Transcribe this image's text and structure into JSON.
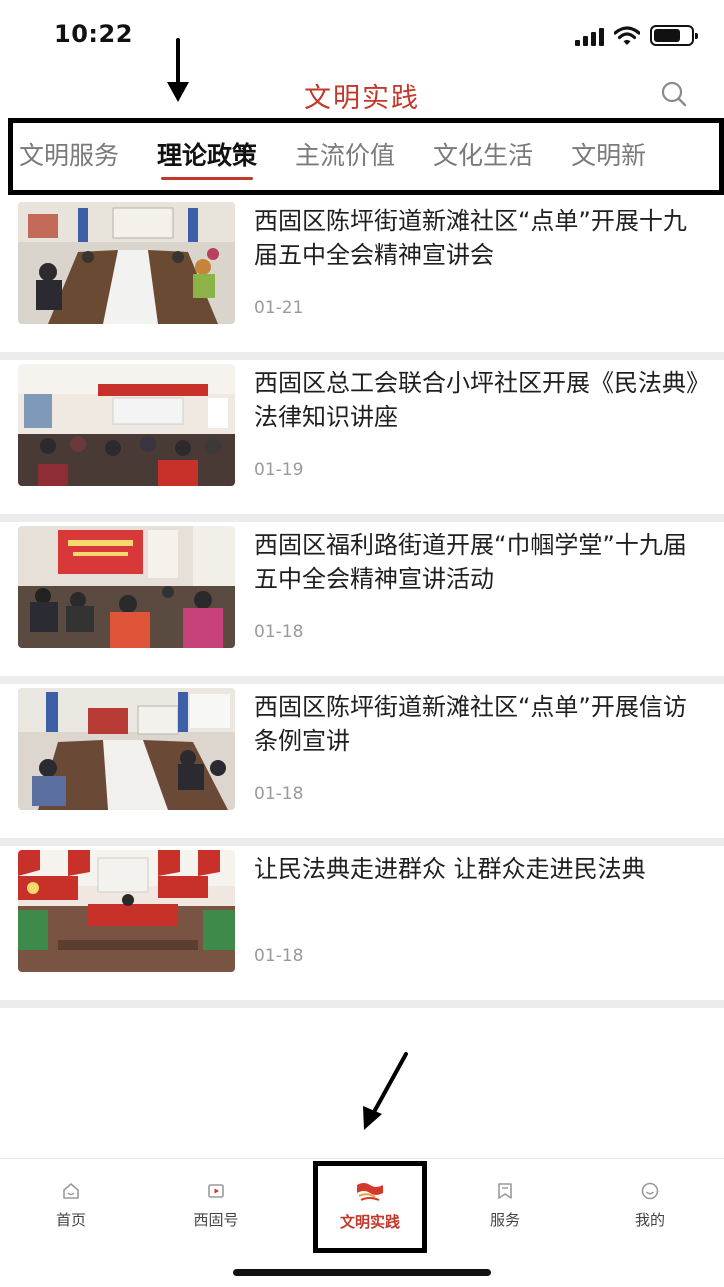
{
  "status_bar": {
    "time": "10:22",
    "icons": [
      "signal-icon",
      "wifi-icon",
      "battery-icon"
    ]
  },
  "header": {
    "title": "文明实践",
    "search_icon": "search-icon"
  },
  "tabs": [
    {
      "label": "文明服务",
      "active": false
    },
    {
      "label": "理论政策",
      "active": true
    },
    {
      "label": "主流价值",
      "active": false
    },
    {
      "label": "文化生活",
      "active": false
    },
    {
      "label": "文明新",
      "active": false
    }
  ],
  "news": [
    {
      "title": "西固区陈坪街道新滩社区“点单”开展十九届五中全会精神宣讲会",
      "date": "01-21"
    },
    {
      "title": "西固区总工会联合小坪社区开展《民法典》法律知识讲座",
      "date": "01-19"
    },
    {
      "title": "西固区福利路街道开展“巾帼学堂”十九届五中全会精神宣讲活动",
      "date": "01-18"
    },
    {
      "title": "西固区陈坪街道新滩社区“点单”开展信访条例宣讲",
      "date": "01-18"
    },
    {
      "title": "让民法典走进群众 让群众走进民法典",
      "date": "01-18"
    }
  ],
  "bottom_nav": [
    {
      "label": "首页",
      "icon": "home-icon",
      "active": false
    },
    {
      "label": "西固号",
      "icon": "video-icon",
      "active": false
    },
    {
      "label": "文明实践",
      "icon": "flag-icon",
      "active": true
    },
    {
      "label": "服务",
      "icon": "bookmark-icon",
      "active": false
    },
    {
      "label": "我的",
      "icon": "user-icon",
      "active": false
    }
  ],
  "colors": {
    "accent": "#c2392b",
    "separator": "#ececec",
    "tab_inactive": "#7a7a7a"
  }
}
